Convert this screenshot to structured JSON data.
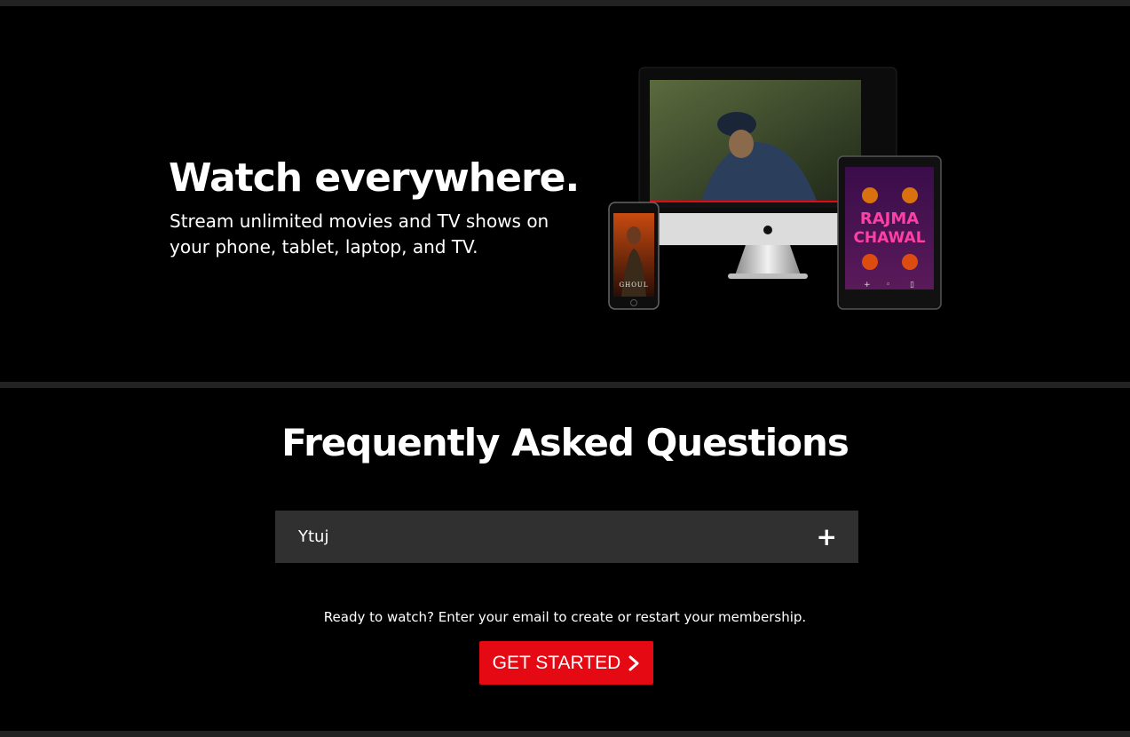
{
  "story": {
    "title": "Watch everywhere.",
    "subtitle": "Stream unlimited movies and TV shows on your phone, tablet, laptop, and TV."
  },
  "devices": {
    "phone_poster_title": "GHOUL",
    "tablet_poster_title_line1": "RAJMA",
    "tablet_poster_title_line2": "CHAWAL"
  },
  "faq": {
    "title": "Frequently Asked Questions",
    "items": [
      {
        "question": "Ytuj",
        "icon": "plus-icon"
      }
    ]
  },
  "cta": {
    "text": "Ready to watch? Enter your email to create or restart your membership.",
    "button_label": "GET STARTED",
    "button_icon": "chevron-right-icon"
  },
  "colors": {
    "background": "#000000",
    "divider": "#222222",
    "faq_item_bg": "#303030",
    "accent": "#e50914"
  }
}
